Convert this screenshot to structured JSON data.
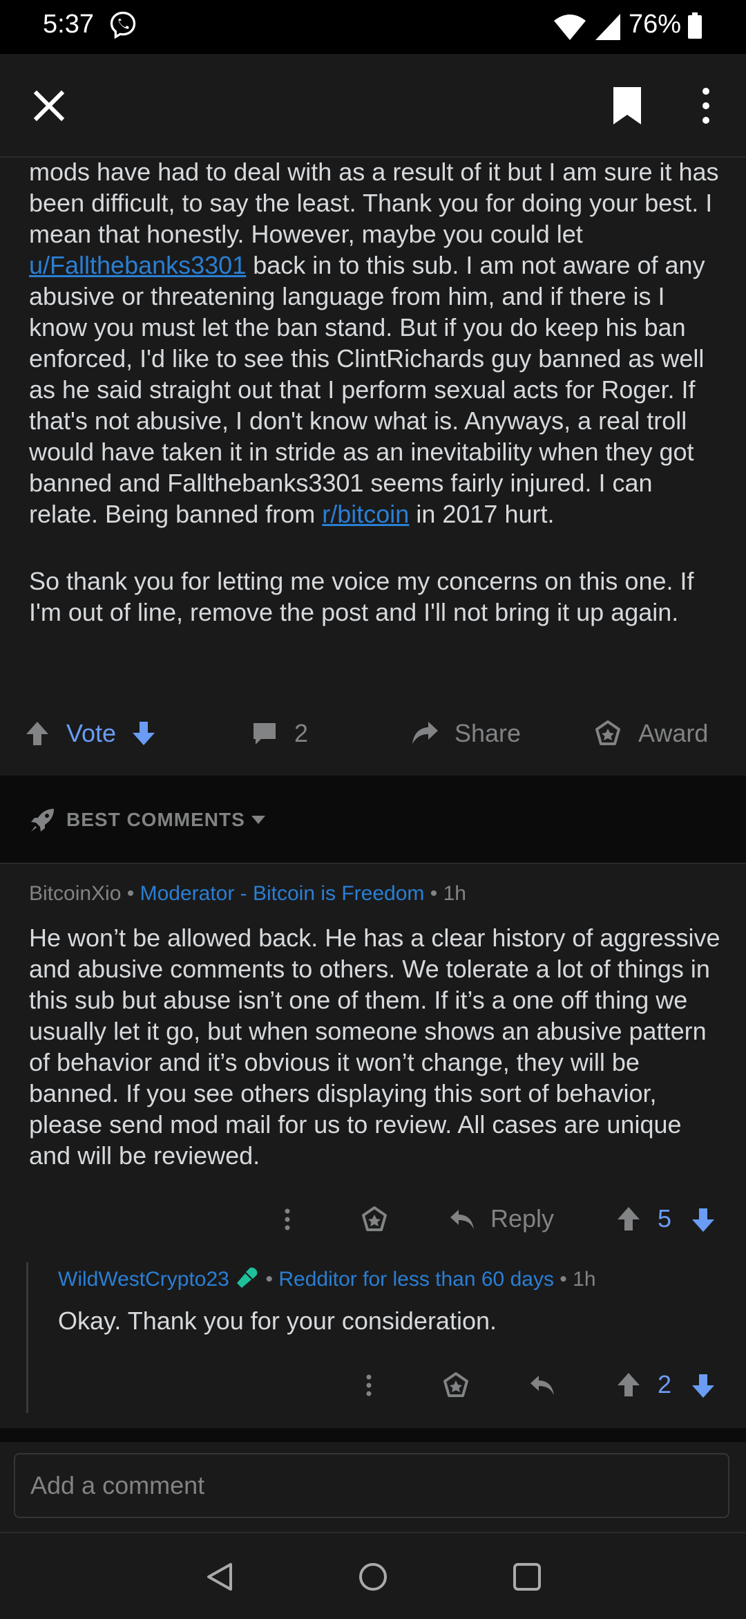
{
  "status_bar": {
    "time": "5:37",
    "battery": "76%"
  },
  "post": {
    "paragraph1_a": "mods have had to deal with as a result of it but I am sure it has been difficult, to say the least. Thank you for doing your best. I mean that honestly. However, maybe you could let ",
    "user_link": "u/Fallthebanks3301",
    "paragraph1_b": " back in to this sub. I am not aware of any abusive or threatening language from him, and if there is I know you must let the ban stand. But if you do keep his ban enforced, I'd like to see this ClintRichards guy banned as well as he said straight out that I perform sexual acts for Roger. If that's not abusive, I don't know what is. Anyways, a real troll would have taken it in stride as an inevitability when they got banned and Fallthebanks3301 seems fairly injured. I can relate. Being banned from ",
    "sub_link": "r/bitcoin",
    "paragraph1_c": " in 2017 hurt.",
    "paragraph2": "So thank you for letting me voice my concerns on this one. If I'm out of line, remove the post and I'll not bring it up again.",
    "actions": {
      "vote": "Vote",
      "comments": "2",
      "share": "Share",
      "award": "Award"
    }
  },
  "sort": {
    "label": "BEST COMMENTS"
  },
  "comments": [
    {
      "author": "BitcoinXio",
      "flair": "Moderator - Bitcoin is Freedom",
      "age": "1h",
      "body": "He won’t be allowed back. He has a clear history of aggressive and abusive comments to others. We tolerate a lot of things in this sub but abuse isn’t one of them. If it’s a one off thing we usually let it go, but when someone shows an abusive pattern of behavior and it’s obvious it won’t change, they will be banned. If you see others displaying this sort of behavior, please send mod mail for us to review. All cases are unique and will be reviewed.",
      "reply_label": "Reply",
      "score": "5"
    },
    {
      "author": "WildWestCrypto23",
      "flair": "Redditor for less than 60 days",
      "age": "1h",
      "body": "Okay. Thank you for your consideration.",
      "score": "2"
    }
  ],
  "comment_input": {
    "placeholder": "Add a comment"
  },
  "colors": {
    "accent_blue": "#6a9cf5",
    "link_blue": "#2a7fd4",
    "flair_blue": "#2a7fd4",
    "mic_green": "#1fbf9a"
  },
  "icons": {
    "statusbar": [
      "viber-icon",
      "wifi-icon",
      "signal-icon",
      "battery-icon"
    ],
    "topbar": [
      "close-icon",
      "bookmark-icon",
      "more-vert-icon"
    ],
    "post_actions": [
      "upvote-icon",
      "downvote-icon",
      "comment-icon",
      "share-icon",
      "award-icon"
    ],
    "comment_actions": [
      "more-icon",
      "award-icon",
      "reply-icon",
      "upvote-icon",
      "downvote-icon"
    ],
    "navbar": [
      "back-icon",
      "home-icon",
      "recents-icon"
    ]
  }
}
